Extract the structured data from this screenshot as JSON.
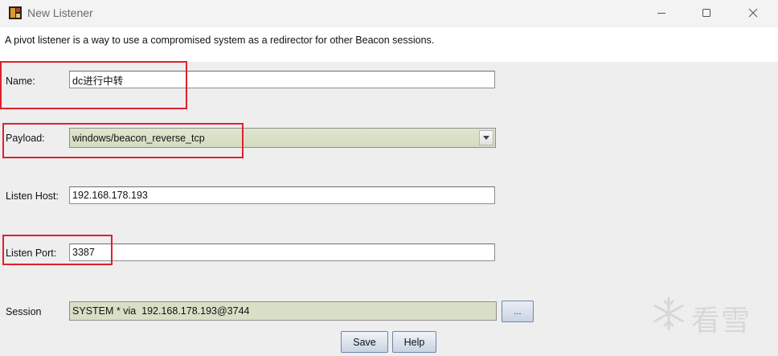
{
  "window": {
    "title": "New Listener"
  },
  "description": "A pivot listener is a way to use a compromised system as a redirector for other Beacon sessions.",
  "form": {
    "name_label": "Name:",
    "name_value": "dc进行中转",
    "payload_label": "Payload:",
    "payload_value": "windows/beacon_reverse_tcp",
    "listen_host_label": "Listen Host:",
    "listen_host_value": "192.168.178.193",
    "listen_port_label": "Listen Port:",
    "listen_port_value": "3387",
    "session_label": "Session",
    "session_value": "SYSTEM * via  192.168.178.193@3744",
    "browse_label": "..."
  },
  "buttons": {
    "save_label": "Save",
    "help_label": "Help"
  },
  "watermark": {
    "text": "看雪"
  },
  "colors": {
    "highlight": "#e0202c",
    "combo_background": "#d3dcc0",
    "session_background": "#d9dfc6"
  }
}
